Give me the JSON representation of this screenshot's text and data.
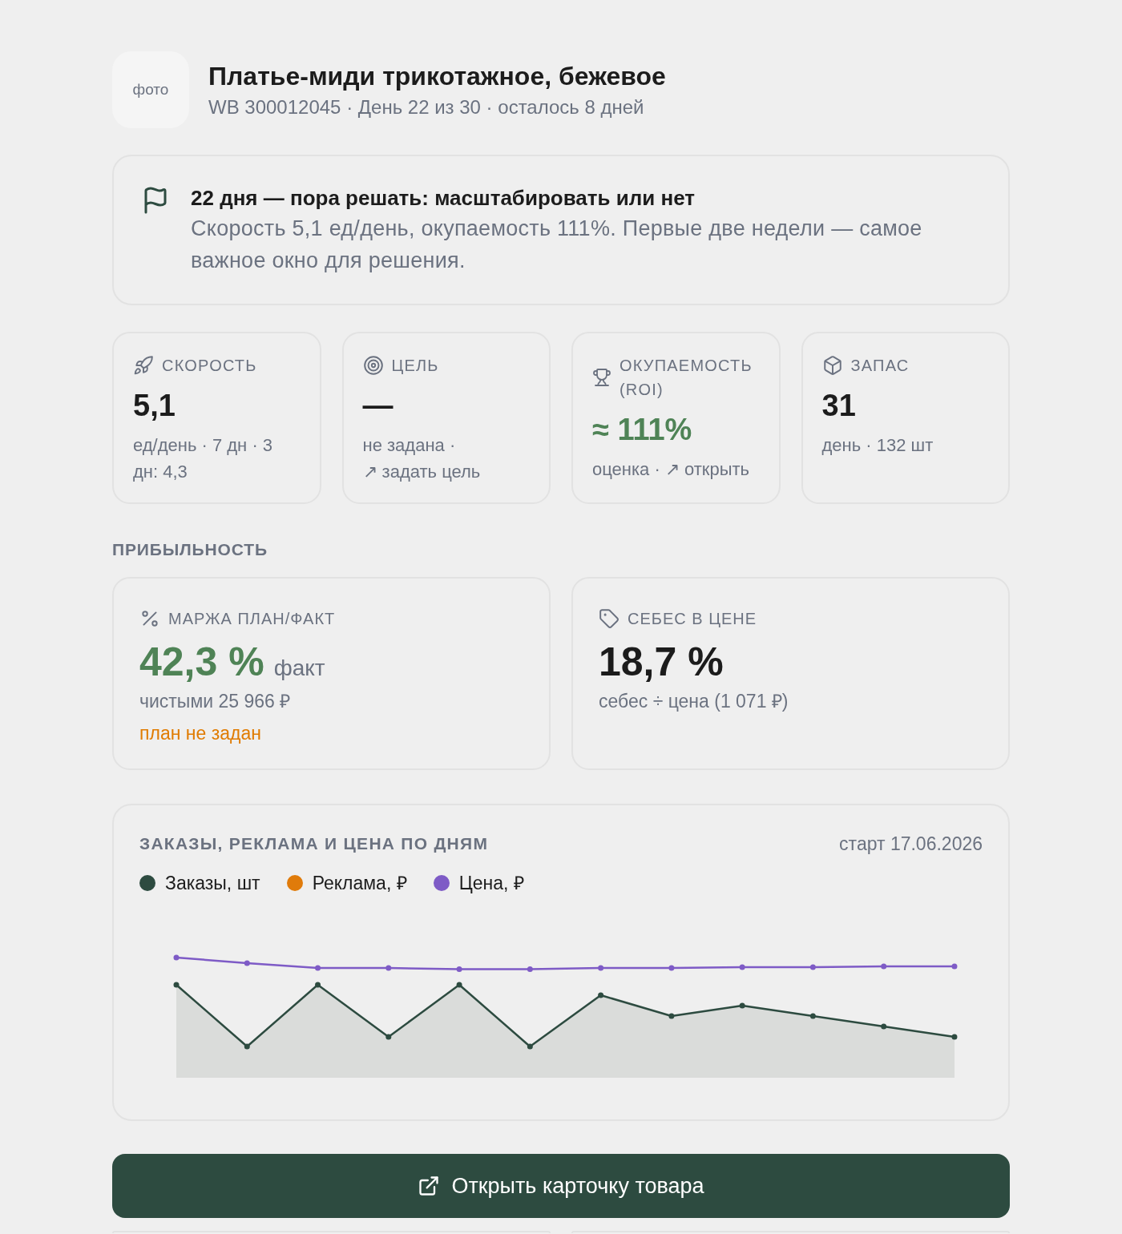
{
  "product": {
    "photo_label": "фото",
    "title": "Платье-миди трикотажное, бежевое",
    "subtitle": "WB 300012045 · День 22 из 30 · осталось 8 дней"
  },
  "notice": {
    "title": "22 дня — пора решать: масштабировать или нет",
    "text": "Скорость 5,1 ед/день, окупаемость 111%. Первые две недели — самое важное окно для решения."
  },
  "metrics": [
    {
      "kind": "speed",
      "label": "СКОРОСТЬ",
      "value": "5,1",
      "positive": false,
      "note": "ед/день · 7 дн · 3 дн: 4,3"
    },
    {
      "kind": "goal",
      "label": "ЦЕЛЬ",
      "value": "—",
      "positive": false,
      "note": "не задана ·",
      "link": "↗ задать цель"
    },
    {
      "kind": "roi",
      "label": "ОКУПАЕМОСТЬ (ROI)",
      "value": "≈ 111%",
      "positive": true,
      "note": "оценка ·",
      "link": "↗ открыть"
    },
    {
      "kind": "stock",
      "label": "ЗАПАС",
      "value": "31",
      "positive": false,
      "note": "день · 132 шт"
    }
  ],
  "profitability": {
    "heading": "ПРИБЫЛЬНОСТЬ",
    "cards": [
      {
        "kind": "margin",
        "label": "МАРЖА ПЛАН/ФАКТ",
        "value": "42,3 %",
        "positive": true,
        "suffix": "факт",
        "lines": [
          {
            "text": "чистыми 25 966 ₽",
            "warning": false
          },
          {
            "text": "план не задан",
            "warning": true
          }
        ]
      },
      {
        "kind": "cost_share",
        "label": "СЕБЕС В ЦЕНЕ",
        "value": "18,7 %",
        "positive": false,
        "lines": [
          {
            "text": "себес ÷ цена (1 071 ₽)",
            "warning": false
          }
        ]
      }
    ]
  },
  "chart": {
    "title": "ЗАКАЗЫ, РЕКЛАМА И ЦЕНА ПО ДНЯМ",
    "start": "старт 17.06.2026",
    "legend": [
      {
        "label": "Заказы, шт",
        "color": "#2d4b40"
      },
      {
        "label": "Реклама, ₽",
        "color": "#e07b0a"
      },
      {
        "label": "Цена, ₽",
        "color": "#7e5bc6"
      }
    ]
  },
  "button": {
    "label": "Открыть карточку товара"
  }
}
